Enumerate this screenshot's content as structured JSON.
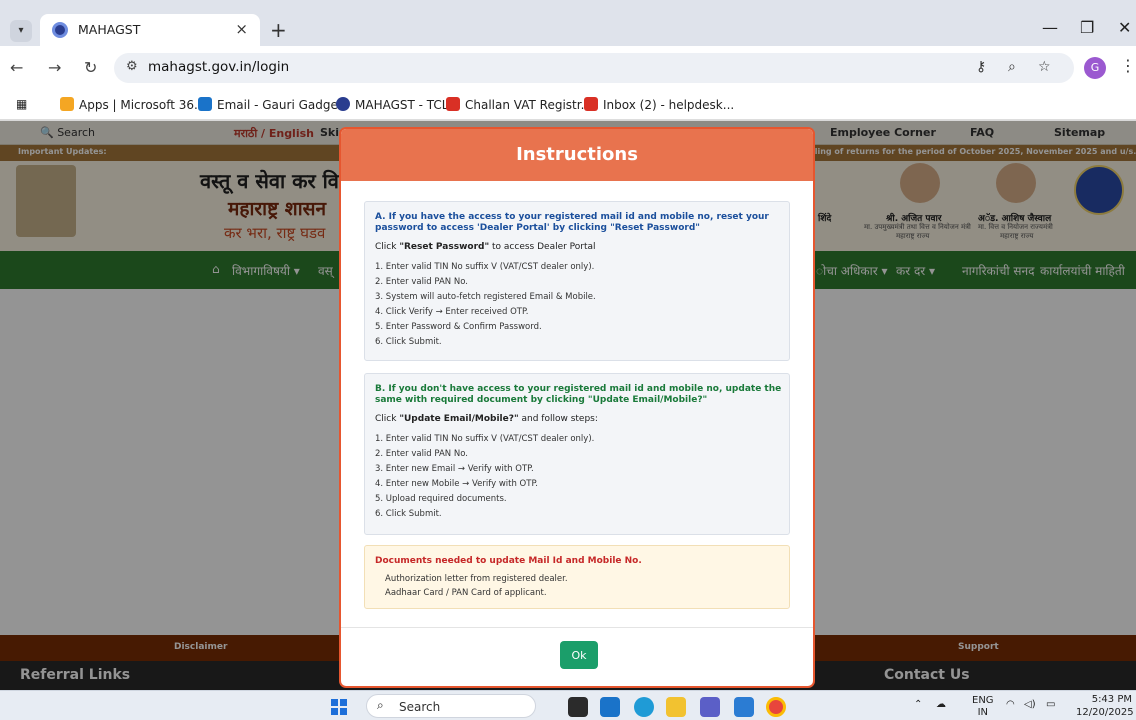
{
  "browser": {
    "tab_title": "MAHAGST",
    "tab_close": "×",
    "new_tab": "+",
    "url": "mahagst.gov.in/login",
    "bookmarks": [
      "Apps | Microsoft 36...",
      "Email - Gauri Gadge...",
      "MAHAGST - TCL",
      "Challan VAT Registr...",
      "Inbox (2) - helpdesk..."
    ],
    "profile_initial": "G"
  },
  "site": {
    "search_label": "Search",
    "language_label": "मराठी / English",
    "skip_label": "Skip",
    "employee_corner": "Employee Corner",
    "faq": "FAQ",
    "sitemap": "Sitemap",
    "important_updates": "Important Updates:",
    "marquee": "iling of returns for the period of October 2025, November 2025 and u/s. 6(3) of",
    "title_line1": "वस्तू व सेवा कर वि",
    "title_line2": "महाराष्ट्र शासन",
    "title_line3": "कर भरा, राष्ट्र घडव",
    "person1_name": "शिंदे",
    "person2_name": "श्री. अजित पवार",
    "person2_title": "मा. उपमुख्यमंत्री तथा वित्त व नियोजन मंत्री",
    "person2_sub": "महाराष्ट्र राज्य",
    "person3_name": "अॅड. आशिष जैस्वाल",
    "person3_title": "मा. वित्त व नियोजन राज्यमंत्री",
    "person3_sub": "महाराष्ट्र राज्य",
    "nav_items": [
      "विभागाविषयी ▾",
      "वस्",
      "ोचा अधिकार ▾",
      "कर दर ▾",
      "नागरिकांची सनद",
      "कार्यालयांची माहिती"
    ],
    "footer_disclaimer": "Disclaimer",
    "footer_support": "Support",
    "referral_links": "Referral Links",
    "contact_us": "Contact Us"
  },
  "modal": {
    "title": "Instructions",
    "section_a": {
      "heading": "A. If you have the access to your registered mail id and mobile no, reset your password to access 'Dealer Portal' by clicking \"Reset Password\"",
      "sub_bold": "\"Reset Password\"",
      "sub_pre": "Click ",
      "sub_post": " to access Dealer Portal",
      "steps": [
        "1. Enter valid TIN No suffix V (VAT/CST dealer only).",
        "2. Enter valid PAN No.",
        "3. System will auto-fetch registered Email & Mobile.",
        "4. Click Verify → Enter received OTP.",
        "5. Enter Password & Confirm Password.",
        "6. Click Submit."
      ]
    },
    "section_b": {
      "heading": "B. If you don't have access to your registered mail id and mobile no, update the same with required document by clicking \"Update Email/Mobile?\"",
      "sub_pre": "Click ",
      "sub_bold": "\"Update Email/Mobile?\"",
      "sub_post": " and follow steps:",
      "steps": [
        "1. Enter valid TIN No suffix V (VAT/CST dealer only).",
        "2. Enter valid PAN No.",
        "3. Enter new Email → Verify with OTP.",
        "4. Enter new Mobile → Verify with OTP.",
        "5. Upload required documents.",
        "6. Click Submit."
      ]
    },
    "documents": {
      "heading": "Documents needed to update Mail Id and Mobile No.",
      "items": [
        "Authorization letter from registered dealer.",
        "Aadhaar Card / PAN Card of applicant."
      ]
    },
    "ok_label": "Ok"
  },
  "taskbar": {
    "search_label": "Search",
    "lang": "ENG",
    "region": "IN",
    "time": "5:43 PM",
    "date": "12/20/2025"
  },
  "colors": {
    "modal_header": "#e8734e",
    "modal_border": "#e6562f",
    "heading_blue": "#1b4f9c",
    "heading_green": "#1a7a3a",
    "heading_red": "#c62828",
    "ok_button": "#1b9e6a",
    "nav_green": "#2f7d2f",
    "footer_brown": "#7a2d05"
  }
}
